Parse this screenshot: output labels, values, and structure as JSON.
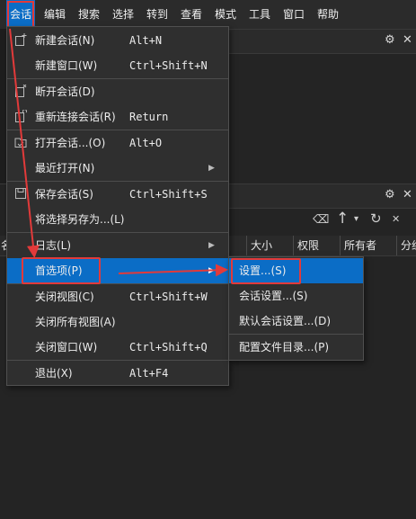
{
  "menubar": {
    "items": [
      "会话",
      "编辑",
      "搜索",
      "选择",
      "转到",
      "查看",
      "模式",
      "工具",
      "窗口",
      "帮助"
    ]
  },
  "colors": {
    "accent": "#0b6dc6",
    "annotation": "#e23a3a",
    "menu_bg": "#2f2f2f"
  },
  "panel_icons": [
    "gear-icon",
    "close-icon",
    "clear-icon",
    "arrow-up-icon",
    "chevron-down-icon",
    "refresh-icon"
  ],
  "glyphs": {
    "gear": "⚙",
    "close": "✕",
    "arrow": "▶",
    "clear": "⌫",
    "up": "↑",
    "dropdown": "▾",
    "refresh": "↻"
  },
  "file_columns": [
    "大小",
    "权限",
    "所有者",
    "分组"
  ],
  "file_columns_cut": [
    "名",
    "分"
  ],
  "session_menu": {
    "items": [
      {
        "label": "新建会话(N)",
        "shortcut": "Alt+N"
      },
      {
        "label": "新建窗口(W)",
        "shortcut": "Ctrl+Shift+N"
      },
      {
        "label": "断开会话(D)",
        "shortcut": ""
      },
      {
        "label": "重新连接会话(R)",
        "shortcut": "Return"
      },
      {
        "label": "打开会话...(O)",
        "shortcut": "Alt+O"
      },
      {
        "label": "最近打开(N)",
        "shortcut": ""
      },
      {
        "label": "保存会话(S)",
        "shortcut": "Ctrl+Shift+S"
      },
      {
        "label": "将选择另存为...(L)",
        "shortcut": ""
      },
      {
        "label": "日志(L)",
        "shortcut": ""
      },
      {
        "label": "首选项(P)",
        "shortcut": ""
      },
      {
        "label": "关闭视图(C)",
        "shortcut": "Ctrl+Shift+W"
      },
      {
        "label": "关闭所有视图(A)",
        "shortcut": ""
      },
      {
        "label": "关闭窗口(W)",
        "shortcut": "Ctrl+Shift+Q"
      },
      {
        "label": "退出(X)",
        "shortcut": "Alt+F4"
      }
    ]
  },
  "preferences_submenu": {
    "items": [
      {
        "label": "设置...(S)"
      },
      {
        "label": "会话设置...(S)"
      },
      {
        "label": "默认会话设置...(D)"
      },
      {
        "label": "配置文件目录...(P)"
      }
    ]
  }
}
